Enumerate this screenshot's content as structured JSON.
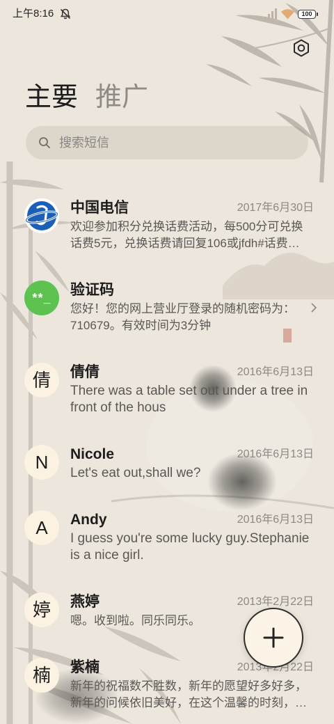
{
  "status_bar": {
    "time": "上午8:16",
    "battery": "100",
    "icons": [
      "mute-icon",
      "signal-icon",
      "wifi-icon",
      "battery-icon"
    ]
  },
  "header": {
    "settings_icon": "settings-icon"
  },
  "tabs": [
    {
      "label": "主要",
      "active": true
    },
    {
      "label": "推广",
      "active": false
    }
  ],
  "search": {
    "placeholder": "搜索短信",
    "icon": "search-icon"
  },
  "conversations": [
    {
      "name": "中国电信",
      "date": "2017年6月30日",
      "preview": "欢迎参加积分兑换话费活动，每500分可兑换话费5元，兑换话费请回复106或jfdh#话费…",
      "avatar": {
        "icon": "china-telecom-logo"
      }
    },
    {
      "name": "验证码",
      "preview": "您好！您的网上营业厅登录的随机密码为：710679。有效时间为3分钟",
      "avatar": {
        "text": "**_"
      },
      "chevron": "chevron-right-icon"
    },
    {
      "name": "倩倩",
      "date": "2016年6月13日",
      "preview": "There was a table set out under a tree in front of the hous",
      "avatar": {
        "text": "倩"
      }
    },
    {
      "name": "Nicole",
      "date": "2016年6月13日",
      "preview": "Let's eat out,shall we?",
      "avatar": {
        "text": "N"
      }
    },
    {
      "name": "Andy",
      "date": "2016年6月13日",
      "preview": "I guess you're some lucky guy.Stephanie is a nice girl.",
      "avatar": {
        "text": "A"
      }
    },
    {
      "name": "燕婷",
      "date": "2013年2月22日",
      "preview": "嗯。收到啦。同乐同乐。",
      "avatar": {
        "text": "婷"
      }
    },
    {
      "name": "紫楠",
      "date": "2013年2月22日",
      "preview": "新年的祝福数不胜数，新年的愿望好多好多，新年的问候依旧美好，在这个温馨的时刻，…",
      "avatar": {
        "text": "楠"
      }
    }
  ],
  "fab": {
    "icon": "plus-icon"
  },
  "colors": {
    "background": "#ece6dc",
    "text_primary": "#1c1c1c",
    "text_secondary": "#8c8983",
    "inactive_tab": "#8e8b86",
    "avatar_background": "#fbf2e2",
    "verification_green": "#5dc250",
    "telecom_blue": "#1b5fb6",
    "wifi": "#e3ab74"
  }
}
